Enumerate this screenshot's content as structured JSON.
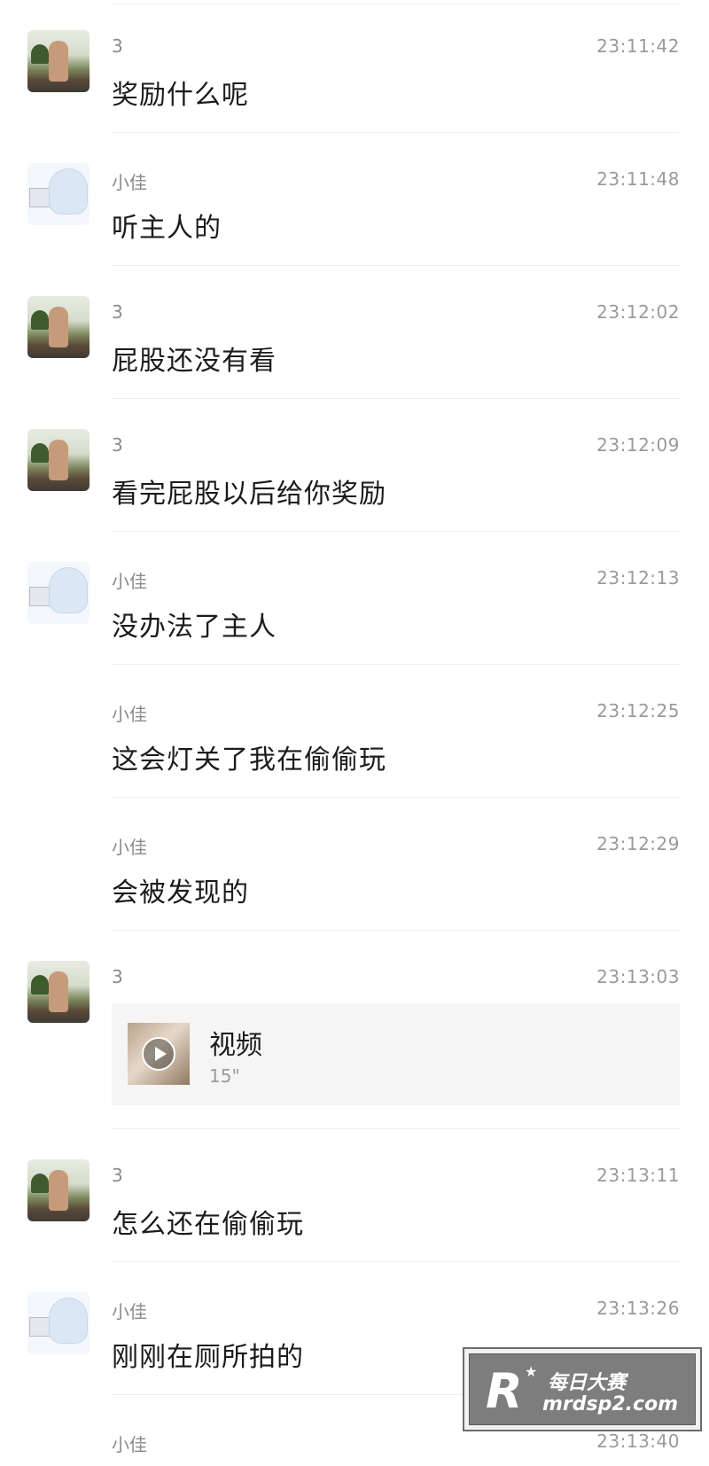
{
  "messages": [
    {
      "sender": "3",
      "time": "23:11:42",
      "text": "奖励什么呢",
      "avatar": "user-3"
    },
    {
      "sender": "小佳",
      "time": "23:11:48",
      "text": "听主人的",
      "avatar": "user-xj"
    },
    {
      "sender": "3",
      "time": "23:12:02",
      "text": "屁股还没有看",
      "avatar": "user-3"
    },
    {
      "sender": "3",
      "time": "23:12:09",
      "text": "看完屁股以后给你奖励",
      "avatar": "user-3"
    },
    {
      "sender": "小佳",
      "time": "23:12:13",
      "text": "没办法了主人",
      "avatar": "user-xj"
    },
    {
      "sender": "小佳",
      "time": "23:12:25",
      "text": "这会灯关了我在偷偷玩",
      "avatar": "none"
    },
    {
      "sender": "小佳",
      "time": "23:12:29",
      "text": "会被发现的",
      "avatar": "none"
    },
    {
      "sender": "3",
      "time": "23:13:03",
      "video_title": "视频",
      "video_duration": "15\"",
      "avatar": "user-3"
    },
    {
      "sender": "3",
      "time": "23:13:11",
      "text": "怎么还在偷偷玩",
      "avatar": "user-3"
    },
    {
      "sender": "小佳",
      "time": "23:13:26",
      "text": "刚刚在厕所拍的",
      "avatar": "user-xj"
    }
  ],
  "partial": {
    "sender": "小佳",
    "time": "23:13:40"
  },
  "watermark": {
    "logo": "R",
    "line1": "每日大赛",
    "line2": "mrdsp2.com"
  }
}
